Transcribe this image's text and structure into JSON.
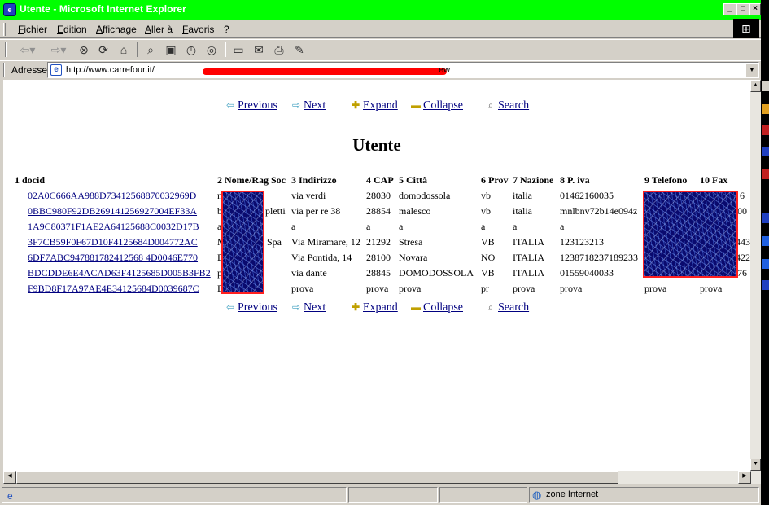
{
  "window": {
    "title": "Utente - Microsoft Internet Explorer",
    "controls": [
      "_",
      "□",
      "×"
    ]
  },
  "menu": {
    "items": [
      "Fichier",
      "Edition",
      "Affichage",
      "Aller à",
      "Favoris",
      "?"
    ]
  },
  "toolbar": {
    "icons": [
      "back-icon",
      "forward-icon",
      "stop-icon",
      "refresh-icon",
      "home-icon",
      "search-icon",
      "favorites-icon",
      "history-icon",
      "fullscreen-icon",
      "mail-icon",
      "print-icon",
      "edit-icon"
    ]
  },
  "address": {
    "label": "Adresse",
    "url": "http://www.carrefour.it/",
    "url_tail": "ew"
  },
  "nav": {
    "previous": "Previous",
    "next": "Next",
    "expand": "Expand",
    "collapse": "Collapse",
    "search": "Search"
  },
  "page": {
    "title": "Utente"
  },
  "table": {
    "headers": [
      "1 docid",
      "2 Nome/Rag Soc",
      "3 Indirizzo",
      "4 CAP",
      "5 Città",
      "6 Prov",
      "7 Nazione",
      "8 P. iva",
      "9 Telefono",
      "10 Fax"
    ],
    "rows": [
      {
        "docid": "02A0C666AA988D73412568870032969D",
        "nome": "m",
        "indirizzo": "via verdi",
        "cap": "28030",
        "citta": "domodossola",
        "prov": "vb",
        "nazione": "italia",
        "piva": "01462160035",
        "telefono": "",
        "fax": "6"
      },
      {
        "docid": "0BBC980F92DB269141256927004EF33A",
        "nome": "b",
        "nome_tail": "pletti",
        "indirizzo": "via per re 38",
        "cap": "28854",
        "citta": "malesco",
        "prov": "vb",
        "nazione": "italia",
        "piva": "mnlbnv72b14e094z",
        "telefono": "",
        "fax": "00"
      },
      {
        "docid": "1A9C80371F1AE2A64125688C0032D17B",
        "nome": "a",
        "indirizzo": "a",
        "cap": "a",
        "citta": "a",
        "prov": "a",
        "nazione": "a",
        "piva": "a",
        "telefono": "",
        "fax": ""
      },
      {
        "docid": "3F7CB59F0F67D10F4125684D004772AC",
        "nome": "M",
        "nome_tail": "Spa",
        "indirizzo": "Via Miramare, 12",
        "cap": "21292",
        "citta": "Stresa",
        "prov": "VB",
        "nazione": "ITALIA",
        "piva": "123123213",
        "telefono": "",
        "fax": "443"
      },
      {
        "docid": "6DF7ABC947881782412568 4D0046E770",
        "nome": "B",
        "indirizzo": "Via Pontida, 14",
        "cap": "28100",
        "citta": "Novara",
        "prov": "NO",
        "nazione": "ITALIA",
        "piva": "1238718237189233",
        "telefono": "",
        "fax": "422"
      },
      {
        "docid": "BDCDDE6E4ACAD63F4125685D005B3FB2",
        "nome": "p",
        "indirizzo": "via dante",
        "cap": "28845",
        "citta": "DOMODOSSOLA",
        "prov": "VB",
        "nazione": "ITALIA",
        "piva": "01559040033",
        "telefono": "",
        "fax": "76"
      },
      {
        "docid": "F9BD8F17A97AE4E34125684D0039687C",
        "nome": "B",
        "indirizzo": "prova",
        "cap": "prova",
        "citta": "prova",
        "prov": "pr",
        "nazione": "prova",
        "piva": "prova",
        "telefono": "prova",
        "fax": "prova"
      }
    ]
  },
  "status": {
    "zone": "zone Internet"
  },
  "colors": {
    "titlebar": "#00ff00",
    "link": "#000080",
    "redaction": "#ff0000",
    "chrome": "#d4d0c8"
  }
}
